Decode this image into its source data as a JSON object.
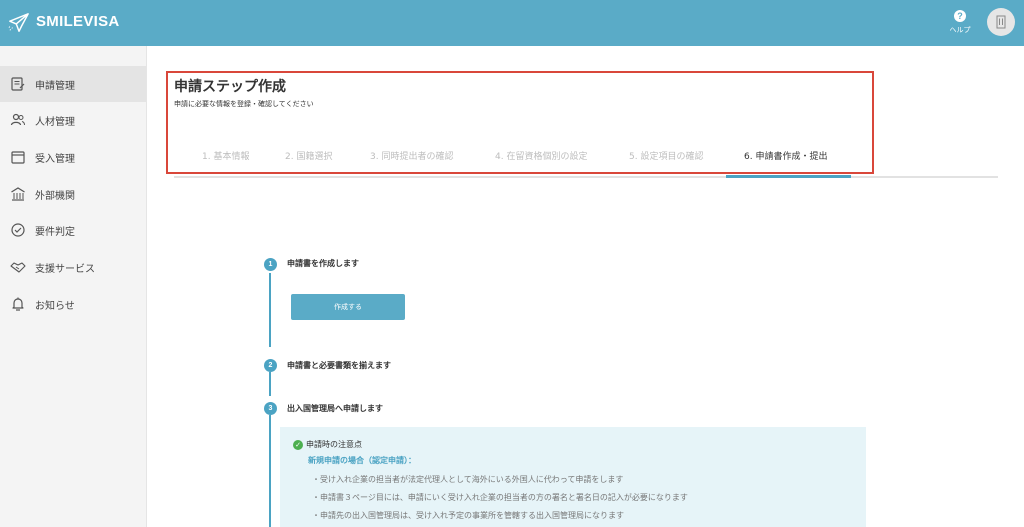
{
  "header": {
    "brand": "SMILEVISA",
    "help_label": "ヘルプ",
    "help_glyph": "?"
  },
  "sidebar": {
    "items": [
      {
        "label": "申請管理",
        "icon": "document-edit-icon",
        "active": true
      },
      {
        "label": "人材管理",
        "icon": "users-icon",
        "active": false
      },
      {
        "label": "受入管理",
        "icon": "calendar-icon",
        "active": false
      },
      {
        "label": "外部機関",
        "icon": "building-icon",
        "active": false
      },
      {
        "label": "要件判定",
        "icon": "check-circle-icon",
        "active": false
      },
      {
        "label": "支援サービス",
        "icon": "handshake-icon",
        "active": false
      },
      {
        "label": "お知らせ",
        "icon": "bell-icon",
        "active": false
      }
    ]
  },
  "main": {
    "title": "申請ステップ作成",
    "subtitle": "申請に必要な情報を登録・確認してください",
    "steps": [
      {
        "label": "1. 基本情報",
        "active": false
      },
      {
        "label": "2. 国籍選択",
        "active": false
      },
      {
        "label": "3. 同時提出者の確認",
        "active": false
      },
      {
        "label": "4. 在留資格個別の設定",
        "active": false
      },
      {
        "label": "5. 設定項目の確認",
        "active": false
      },
      {
        "label": "6. 申請書作成・提出",
        "active": true
      }
    ],
    "timeline": [
      {
        "number": "1",
        "title": "申請書を作成します"
      },
      {
        "number": "2",
        "title": "申請書と必要書類を揃えます"
      },
      {
        "number": "3",
        "title": "出入国管理局へ申請します"
      }
    ],
    "create_button": "作成する",
    "notes": {
      "heading": "申請時の注意点",
      "check_glyph": "✓",
      "subheading": "新規申請の場合（認定申請）：",
      "lines": [
        "・受け入れ企業の担当者が法定代理人として海外にいる外国人に代わって申請をします",
        "・申請書３ページ目には、申請にいく受け入れ企業の担当者の方の署名と署名日の記入が必要になります",
        "・申請先の出入国管理局は、受け入れ予定の事業所を管轄する出入国管理局になります"
      ]
    }
  },
  "colors": {
    "header": "#5aabc7",
    "accent": "#4ba3c3",
    "highlight_border": "#d9473a",
    "notes_bg": "#e6f4f8",
    "check": "#4caf50"
  }
}
